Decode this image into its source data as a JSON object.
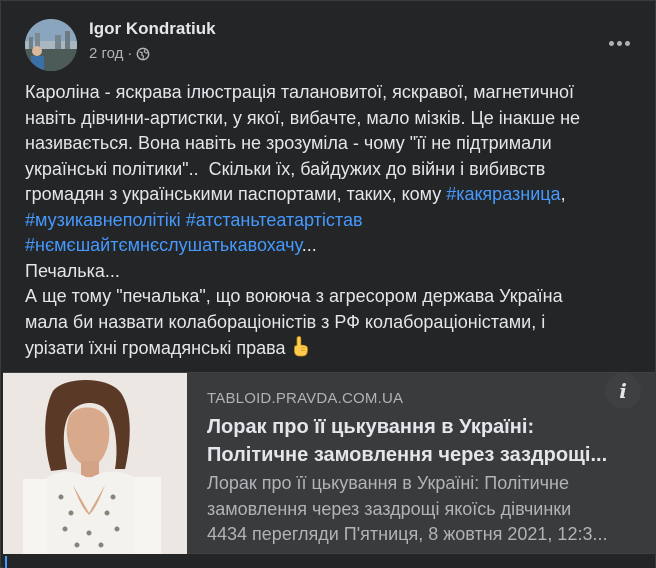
{
  "post": {
    "author": "Igor Kondratiuk",
    "time": "2 год",
    "privacy_icon": "globe-icon",
    "more_icon": "more-horizontal-icon"
  },
  "body": {
    "line1": "Кароліна - яскрава ілюстрація талановитої, яскравої, магнетичної",
    "line2": "навіть дівчини-артистки, у якої, вибачте, мало мізків. Це інакше не",
    "line3": "називається. Вона навіть не зрозуміла - чому \"її не підтримали",
    "line4": "українські політики\"..  Скільки їх, байдужих до війни і вибивств",
    "line5_text": "громадян з українськими паспортами, таких, кому ",
    "hashtag1": "#какяразница",
    "line5_end": ",",
    "hashtag2": "#музикавнеполітікі",
    "hashtag3": "#атстаньтеатартістав",
    "hashtag4": "#нємєшайтємнєслушатькавохачу",
    "ellipsis": "...",
    "line8": "Печалька...",
    "line9": "А ще тому \"печалька\", що воююча з агресором держава Україна",
    "line10": "мала би назвати колабораціоністів з РФ колабораціоністами, і",
    "line11": "урізати їхні громадянські права",
    "emoji_icon": "index-pointing-up-icon"
  },
  "link_card": {
    "domain": "TABLOID.PRAVDA.COM.UA",
    "title": "Лорак про її цькування в Україні: Політичне замовлення через заздрощі якоїсь дівчинки",
    "title_line1": "Лорак про її цькування в Україні:",
    "title_line2": "Політичне замовлення через заздрощі...",
    "desc_line1": "Лорак про її цькування в Україні: Політичне",
    "desc_line2": "замовлення через заздрощі якоїсь дівчинки",
    "desc_line3": "4434 перегляди П'ятниця, 8 жовтня 2021, 12:3...",
    "info_label": "i"
  },
  "colors": {
    "background": "#242526",
    "text": "#e4e6eb",
    "secondary_text": "#b0b3b8",
    "hashtag": "#4599ff",
    "card": "#3a3b3c"
  }
}
